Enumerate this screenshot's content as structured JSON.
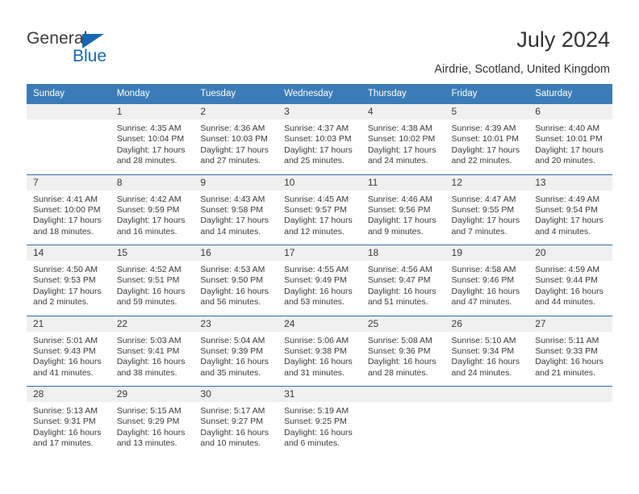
{
  "brand": {
    "name_part1": "General",
    "name_part2": "Blue",
    "triangle_color": "#1567b3",
    "text_color": "#3a3a3a"
  },
  "header": {
    "title": "July 2024",
    "subtitle": "Airdrie, Scotland, United Kingdom"
  },
  "theme": {
    "header_blue": "#3b7cb8",
    "separator_blue": "#2f6fab",
    "daynum_bg": "#f0f0f0",
    "text": "#3a3a3a"
  },
  "calendar": {
    "weekday_headers": [
      "Sunday",
      "Monday",
      "Tuesday",
      "Wednesday",
      "Thursday",
      "Friday",
      "Saturday"
    ],
    "weeks": [
      [
        {
          "day": "",
          "sunrise": "",
          "sunset": "",
          "daylight1": "",
          "daylight2": ""
        },
        {
          "day": "1",
          "sunrise": "Sunrise: 4:35 AM",
          "sunset": "Sunset: 10:04 PM",
          "daylight1": "Daylight: 17 hours",
          "daylight2": "and 28 minutes."
        },
        {
          "day": "2",
          "sunrise": "Sunrise: 4:36 AM",
          "sunset": "Sunset: 10:03 PM",
          "daylight1": "Daylight: 17 hours",
          "daylight2": "and 27 minutes."
        },
        {
          "day": "3",
          "sunrise": "Sunrise: 4:37 AM",
          "sunset": "Sunset: 10:03 PM",
          "daylight1": "Daylight: 17 hours",
          "daylight2": "and 25 minutes."
        },
        {
          "day": "4",
          "sunrise": "Sunrise: 4:38 AM",
          "sunset": "Sunset: 10:02 PM",
          "daylight1": "Daylight: 17 hours",
          "daylight2": "and 24 minutes."
        },
        {
          "day": "5",
          "sunrise": "Sunrise: 4:39 AM",
          "sunset": "Sunset: 10:01 PM",
          "daylight1": "Daylight: 17 hours",
          "daylight2": "and 22 minutes."
        },
        {
          "day": "6",
          "sunrise": "Sunrise: 4:40 AM",
          "sunset": "Sunset: 10:01 PM",
          "daylight1": "Daylight: 17 hours",
          "daylight2": "and 20 minutes."
        }
      ],
      [
        {
          "day": "7",
          "sunrise": "Sunrise: 4:41 AM",
          "sunset": "Sunset: 10:00 PM",
          "daylight1": "Daylight: 17 hours",
          "daylight2": "and 18 minutes."
        },
        {
          "day": "8",
          "sunrise": "Sunrise: 4:42 AM",
          "sunset": "Sunset: 9:59 PM",
          "daylight1": "Daylight: 17 hours",
          "daylight2": "and 16 minutes."
        },
        {
          "day": "9",
          "sunrise": "Sunrise: 4:43 AM",
          "sunset": "Sunset: 9:58 PM",
          "daylight1": "Daylight: 17 hours",
          "daylight2": "and 14 minutes."
        },
        {
          "day": "10",
          "sunrise": "Sunrise: 4:45 AM",
          "sunset": "Sunset: 9:57 PM",
          "daylight1": "Daylight: 17 hours",
          "daylight2": "and 12 minutes."
        },
        {
          "day": "11",
          "sunrise": "Sunrise: 4:46 AM",
          "sunset": "Sunset: 9:56 PM",
          "daylight1": "Daylight: 17 hours",
          "daylight2": "and 9 minutes."
        },
        {
          "day": "12",
          "sunrise": "Sunrise: 4:47 AM",
          "sunset": "Sunset: 9:55 PM",
          "daylight1": "Daylight: 17 hours",
          "daylight2": "and 7 minutes."
        },
        {
          "day": "13",
          "sunrise": "Sunrise: 4:49 AM",
          "sunset": "Sunset: 9:54 PM",
          "daylight1": "Daylight: 17 hours",
          "daylight2": "and 4 minutes."
        }
      ],
      [
        {
          "day": "14",
          "sunrise": "Sunrise: 4:50 AM",
          "sunset": "Sunset: 9:53 PM",
          "daylight1": "Daylight: 17 hours",
          "daylight2": "and 2 minutes."
        },
        {
          "day": "15",
          "sunrise": "Sunrise: 4:52 AM",
          "sunset": "Sunset: 9:51 PM",
          "daylight1": "Daylight: 16 hours",
          "daylight2": "and 59 minutes."
        },
        {
          "day": "16",
          "sunrise": "Sunrise: 4:53 AM",
          "sunset": "Sunset: 9:50 PM",
          "daylight1": "Daylight: 16 hours",
          "daylight2": "and 56 minutes."
        },
        {
          "day": "17",
          "sunrise": "Sunrise: 4:55 AM",
          "sunset": "Sunset: 9:49 PM",
          "daylight1": "Daylight: 16 hours",
          "daylight2": "and 53 minutes."
        },
        {
          "day": "18",
          "sunrise": "Sunrise: 4:56 AM",
          "sunset": "Sunset: 9:47 PM",
          "daylight1": "Daylight: 16 hours",
          "daylight2": "and 51 minutes."
        },
        {
          "day": "19",
          "sunrise": "Sunrise: 4:58 AM",
          "sunset": "Sunset: 9:46 PM",
          "daylight1": "Daylight: 16 hours",
          "daylight2": "and 47 minutes."
        },
        {
          "day": "20",
          "sunrise": "Sunrise: 4:59 AM",
          "sunset": "Sunset: 9:44 PM",
          "daylight1": "Daylight: 16 hours",
          "daylight2": "and 44 minutes."
        }
      ],
      [
        {
          "day": "21",
          "sunrise": "Sunrise: 5:01 AM",
          "sunset": "Sunset: 9:43 PM",
          "daylight1": "Daylight: 16 hours",
          "daylight2": "and 41 minutes."
        },
        {
          "day": "22",
          "sunrise": "Sunrise: 5:03 AM",
          "sunset": "Sunset: 9:41 PM",
          "daylight1": "Daylight: 16 hours",
          "daylight2": "and 38 minutes."
        },
        {
          "day": "23",
          "sunrise": "Sunrise: 5:04 AM",
          "sunset": "Sunset: 9:39 PM",
          "daylight1": "Daylight: 16 hours",
          "daylight2": "and 35 minutes."
        },
        {
          "day": "24",
          "sunrise": "Sunrise: 5:06 AM",
          "sunset": "Sunset: 9:38 PM",
          "daylight1": "Daylight: 16 hours",
          "daylight2": "and 31 minutes."
        },
        {
          "day": "25",
          "sunrise": "Sunrise: 5:08 AM",
          "sunset": "Sunset: 9:36 PM",
          "daylight1": "Daylight: 16 hours",
          "daylight2": "and 28 minutes."
        },
        {
          "day": "26",
          "sunrise": "Sunrise: 5:10 AM",
          "sunset": "Sunset: 9:34 PM",
          "daylight1": "Daylight: 16 hours",
          "daylight2": "and 24 minutes."
        },
        {
          "day": "27",
          "sunrise": "Sunrise: 5:11 AM",
          "sunset": "Sunset: 9:33 PM",
          "daylight1": "Daylight: 16 hours",
          "daylight2": "and 21 minutes."
        }
      ],
      [
        {
          "day": "28",
          "sunrise": "Sunrise: 5:13 AM",
          "sunset": "Sunset: 9:31 PM",
          "daylight1": "Daylight: 16 hours",
          "daylight2": "and 17 minutes."
        },
        {
          "day": "29",
          "sunrise": "Sunrise: 5:15 AM",
          "sunset": "Sunset: 9:29 PM",
          "daylight1": "Daylight: 16 hours",
          "daylight2": "and 13 minutes."
        },
        {
          "day": "30",
          "sunrise": "Sunrise: 5:17 AM",
          "sunset": "Sunset: 9:27 PM",
          "daylight1": "Daylight: 16 hours",
          "daylight2": "and 10 minutes."
        },
        {
          "day": "31",
          "sunrise": "Sunrise: 5:19 AM",
          "sunset": "Sunset: 9:25 PM",
          "daylight1": "Daylight: 16 hours",
          "daylight2": "and 6 minutes."
        },
        {
          "day": "",
          "sunrise": "",
          "sunset": "",
          "daylight1": "",
          "daylight2": ""
        },
        {
          "day": "",
          "sunrise": "",
          "sunset": "",
          "daylight1": "",
          "daylight2": ""
        },
        {
          "day": "",
          "sunrise": "",
          "sunset": "",
          "daylight1": "",
          "daylight2": ""
        }
      ]
    ]
  }
}
